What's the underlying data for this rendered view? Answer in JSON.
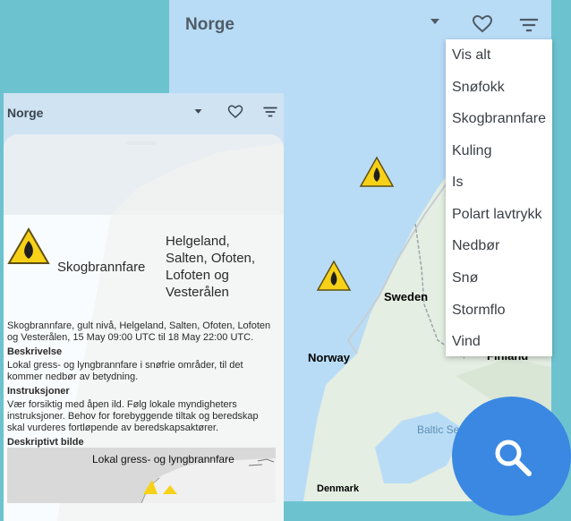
{
  "back": {
    "title": "Norge",
    "icons": [
      "chevron-down-icon",
      "heart-outline-icon",
      "filter-sort-icon"
    ],
    "map_labels": {
      "sweden": "Sweden",
      "norway": "Norway",
      "finland": "Finland",
      "baltic": "Baltic Se",
      "denmark": "Denmark",
      "sea": "Sea"
    }
  },
  "menu": {
    "items": [
      "Vis alt",
      "Snøfokk",
      "Skogbrannfare",
      "Kuling",
      "Is",
      "Polart lavtrykk",
      "Nedbør",
      "Snø",
      "Stormflo",
      "Vind"
    ]
  },
  "front": {
    "title": "Norge",
    "warning": {
      "type": "Skogbrannfare",
      "area": "Helgeland, Salten, Ofoten, Lofoten og Vesterålen",
      "summary": "Skogbrannfare, gult nivå, Helgeland, Salten, Ofoten, Lofoten og Vesterålen, 15 May 09:00 UTC til 18 May 22:00 UTC.",
      "description_heading": "Beskrivelse",
      "description": "Lokal gress- og lyngbrannfare i snøfrie områder, til det kommer nedbør av betydning.",
      "instructions_heading": "Instruksjoner",
      "instructions": "Vær forsiktig med åpen ild. Følg lokale myndigheters instruksjoner. Behov for forebyggende tiltak og beredskap skal vurderes fortløpende av beredskapsaktører.",
      "image_heading": "Deskriptivt bilde",
      "image_caption": "Lokal gress- og lyngbrannfare"
    }
  },
  "colors": {
    "accent": "#3a88e2",
    "warning_yellow": "#f7d117",
    "background": "#6cc3cf"
  }
}
